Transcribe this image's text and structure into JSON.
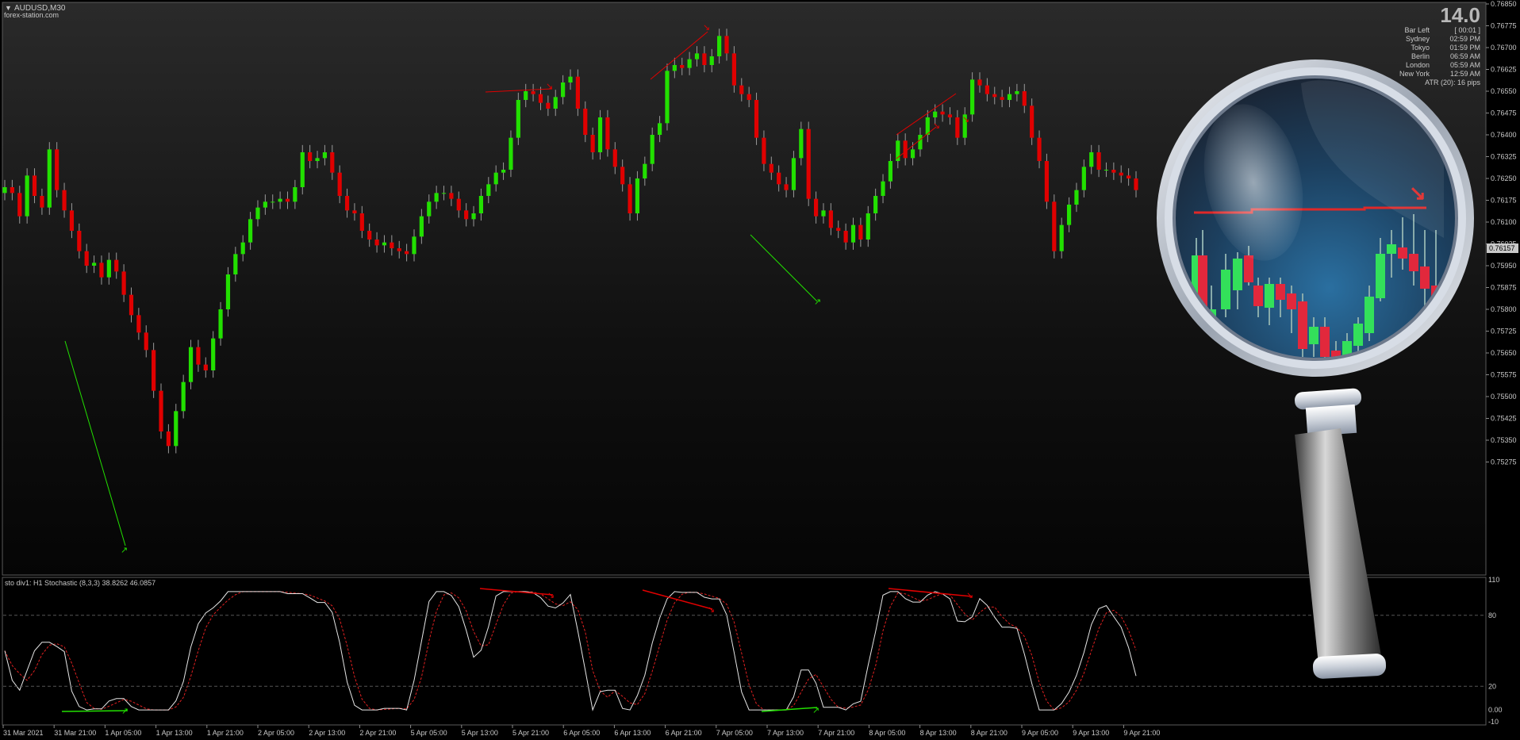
{
  "window": {
    "symbol_label": "AUDUSD,M30",
    "watermark": "forex-station.com"
  },
  "info_panel": {
    "bar_timer": "14.0",
    "rows": [
      {
        "label": "Bar Left",
        "value": "[ 00:01 ]"
      },
      {
        "label": "Sydney",
        "value": "02:59 PM"
      },
      {
        "label": "Tokyo",
        "value": "01:59 PM"
      },
      {
        "label": "Berlin",
        "value": "06:59 AM"
      },
      {
        "label": "London",
        "value": "05:59 AM"
      },
      {
        "label": "New York",
        "value": "12:59 AM"
      }
    ],
    "atr": "ATR (20): 16 pips"
  },
  "current_price": "0.76157",
  "price_axis": [
    "0.76850",
    "0.76775",
    "0.76700",
    "0.76625",
    "0.76550",
    "0.76475",
    "0.76400",
    "0.76325",
    "0.76250",
    "0.76175",
    "0.76100",
    "0.76025",
    "0.75950",
    "0.75875",
    "0.75800",
    "0.75725",
    "0.75650",
    "0.75575",
    "0.75500",
    "0.75425",
    "0.75350",
    "0.75275"
  ],
  "indicator": {
    "label": "sto div1: H1 Stochastic (8,3,3) 38.8262 46.0857",
    "axis": [
      "110",
      "80",
      "20",
      "0.00",
      "-10"
    ],
    "levels": [
      80,
      20
    ]
  },
  "time_axis": [
    "31 Mar 2021",
    "31 Mar 21:00",
    "1 Apr 05:00",
    "1 Apr 13:00",
    "1 Apr 21:00",
    "2 Apr 05:00",
    "2 Apr 13:00",
    "2 Apr 21:00",
    "5 Apr 05:00",
    "5 Apr 13:00",
    "5 Apr 21:00",
    "6 Apr 05:00",
    "6 Apr 13:00",
    "6 Apr 21:00",
    "7 Apr 05:00",
    "7 Apr 13:00",
    "7 Apr 21:00",
    "8 Apr 05:00",
    "8 Apr 13:00",
    "8 Apr 21:00",
    "9 Apr 05:00",
    "9 Apr 13:00",
    "9 Apr 21:00"
  ],
  "colors": {
    "bull": "#22e000",
    "bear": "#e00000",
    "grid": "#3a3a3a",
    "text": "#c8c8c8",
    "main_line": "#e6e6e6",
    "signal_line": "#e02020"
  },
  "price_path": [
    0.7622,
    0.762,
    0.7612,
    0.7626,
    0.7619,
    0.7615,
    0.7635,
    0.7621,
    0.7614,
    0.7607,
    0.76,
    0.7595,
    0.7596,
    0.7591,
    0.7597,
    0.7593,
    0.7585,
    0.7578,
    0.7572,
    0.7566,
    0.7552,
    0.7538,
    0.7533,
    0.7545,
    0.7555,
    0.7567,
    0.7561,
    0.7559,
    0.757,
    0.758,
    0.7592,
    0.7599,
    0.7603,
    0.7611,
    0.7615,
    0.7617,
    0.7617,
    0.7618,
    0.7617,
    0.7622,
    0.7634,
    0.7631,
    0.7632,
    0.7634,
    0.7627,
    0.7619,
    0.7614,
    0.7613,
    0.7607,
    0.7604,
    0.7602,
    0.7603,
    0.7601,
    0.76,
    0.7599,
    0.7605,
    0.7612,
    0.7617,
    0.762,
    0.762,
    0.7618,
    0.7614,
    0.7611,
    0.7613,
    0.7619,
    0.7623,
    0.7627,
    0.7628,
    0.7639,
    0.7652,
    0.7655,
    0.7654,
    0.7651,
    0.7649,
    0.7653,
    0.7658,
    0.766,
    0.7649,
    0.764,
    0.7634,
    0.7646,
    0.7635,
    0.7629,
    0.7623,
    0.7613,
    0.7625,
    0.763,
    0.764,
    0.7644,
    0.7662,
    0.7664,
    0.7663,
    0.7666,
    0.7668,
    0.7664,
    0.7667,
    0.7674,
    0.7668,
    0.7657,
    0.7654,
    0.7652,
    0.7639,
    0.763,
    0.7627,
    0.7623,
    0.7621,
    0.7632,
    0.7642,
    0.7618,
    0.7612,
    0.7614,
    0.7608,
    0.7607,
    0.7603,
    0.7609,
    0.7604,
    0.7613,
    0.7619,
    0.7624,
    0.7631,
    0.7638,
    0.7632,
    0.7635,
    0.764,
    0.7646,
    0.7648,
    0.7647,
    0.7646,
    0.7639,
    0.7647,
    0.7659,
    0.7657,
    0.7654,
    0.7653,
    0.7652,
    0.7654,
    0.7655,
    0.765,
    0.7639,
    0.7631,
    0.7617,
    0.76,
    0.7609,
    0.7616,
    0.7621,
    0.7629,
    0.7634,
    0.7628,
    0.7628,
    0.7627,
    0.7626,
    0.7625,
    0.7621
  ]
}
